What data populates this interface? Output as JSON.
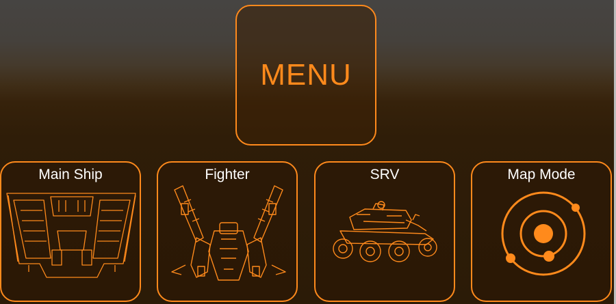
{
  "menu": {
    "label": "MENU"
  },
  "tiles": [
    {
      "label": "Main Ship",
      "icon": "main-ship-icon"
    },
    {
      "label": "Fighter",
      "icon": "fighter-icon"
    },
    {
      "label": "SRV",
      "icon": "srv-icon"
    },
    {
      "label": "Map Mode",
      "icon": "orbit-map-icon"
    }
  ],
  "colors": {
    "accent": "#ff8a1c",
    "label": "#ffffff",
    "panel": "#2b1b07"
  }
}
